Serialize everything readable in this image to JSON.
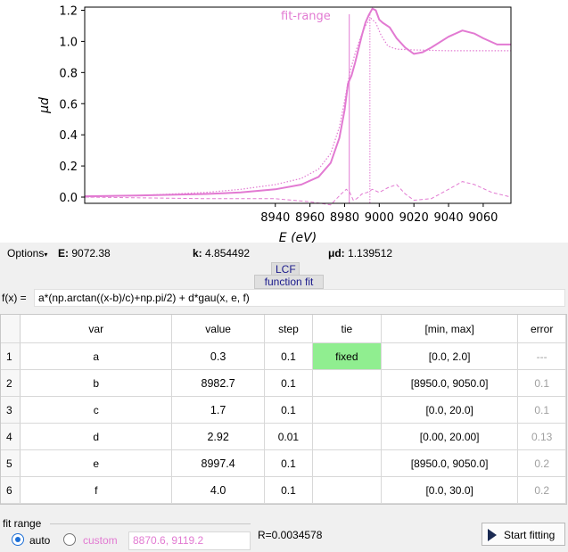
{
  "chart_data": {
    "type": "line",
    "xlabel": "E (eV)",
    "ylabel": "μd",
    "xlim": [
      8830,
      9076
    ],
    "ylim": [
      -0.04,
      1.22
    ],
    "xticks": [
      8940,
      8960,
      8980,
      9000,
      9020,
      9040,
      9060
    ],
    "yticks": [
      "0.0",
      "0.2",
      "0.4",
      "0.6",
      "0.8",
      "1.0",
      "1.2"
    ],
    "annotation": "fit-range",
    "fit_range": [
      8870.6,
      9119.2
    ],
    "markers_x": [
      8982.7,
      8994.6
    ],
    "series": [
      {
        "style": "solid",
        "x": [
          8830,
          8860,
          8900,
          8920,
          8940,
          8955,
          8965,
          8972,
          8977,
          8980,
          8982,
          8984,
          8986,
          8988,
          8990,
          8992,
          8994,
          8996,
          8998,
          9000,
          9002,
          9006,
          9010,
          9015,
          9020,
          9025,
          9030,
          9040,
          9048,
          9055,
          9060,
          9068,
          9076
        ],
        "y": [
          0.005,
          0.01,
          0.02,
          0.03,
          0.05,
          0.08,
          0.13,
          0.22,
          0.38,
          0.56,
          0.73,
          0.78,
          0.86,
          0.95,
          1.04,
          1.12,
          1.17,
          1.21,
          1.2,
          1.14,
          1.12,
          1.09,
          1.02,
          0.96,
          0.92,
          0.93,
          0.96,
          1.03,
          1.07,
          1.05,
          1.02,
          0.98,
          0.98
        ]
      },
      {
        "style": "dotted",
        "x": [
          8830,
          8860,
          8900,
          8920,
          8940,
          8955,
          8965,
          8972,
          8977,
          8980,
          8983,
          8986,
          8989,
          8992,
          8995,
          8998,
          9001,
          9005,
          9010,
          9020,
          9040,
          9076
        ],
        "y": [
          0.0,
          0.01,
          0.03,
          0.05,
          0.08,
          0.12,
          0.18,
          0.28,
          0.45,
          0.62,
          0.8,
          0.92,
          1.02,
          1.1,
          1.15,
          1.12,
          1.04,
          0.97,
          0.95,
          0.945,
          0.94,
          0.94
        ]
      },
      {
        "style": "dashed",
        "x": [
          8830,
          8900,
          8940,
          8960,
          8972,
          8978,
          8981,
          8983,
          8985,
          8987,
          8990,
          8993,
          8996,
          9000,
          9005,
          9010,
          9015,
          9020,
          9030,
          9040,
          9048,
          9055,
          9065,
          9076
        ],
        "y": [
          0.0,
          -0.01,
          -0.01,
          -0.03,
          -0.05,
          0.02,
          0.05,
          0.03,
          -0.02,
          -0.01,
          0.02,
          0.03,
          0.05,
          0.03,
          0.06,
          0.08,
          0.02,
          -0.02,
          -0.01,
          0.05,
          0.1,
          0.08,
          0.03,
          0.0
        ]
      }
    ],
    "colors": {
      "curve": "#e27ad2",
      "axis": "#000000"
    }
  },
  "status": {
    "options_label": "Options",
    "e_label": "E:",
    "e_value": "9072.38",
    "k_label": "k:",
    "k_value": "4.854492",
    "mud_label": "μd:",
    "mud_value": "1.139512"
  },
  "tabs": {
    "lcf": "LCF",
    "function_fit": "function fit"
  },
  "formula": {
    "label": "f(x) =",
    "value": "a*(np.arctan((x-b)/c)+np.pi/2) + d*gau(x, e, f)"
  },
  "table": {
    "headers": [
      "var",
      "value",
      "step",
      "tie",
      "[min, max]",
      "error"
    ],
    "rows": [
      {
        "num": "1",
        "var": "a",
        "value": "0.3",
        "step": "0.1",
        "tie": "fixed",
        "range": "[0.0, 2.0]",
        "error": "---"
      },
      {
        "num": "2",
        "var": "b",
        "value": "8982.7",
        "step": "0.1",
        "tie": "",
        "range": "[8950.0, 9050.0]",
        "error": "0.1"
      },
      {
        "num": "3",
        "var": "c",
        "value": "1.7",
        "step": "0.1",
        "tie": "",
        "range": "[0.0, 20.0]",
        "error": "0.1"
      },
      {
        "num": "4",
        "var": "d",
        "value": "2.92",
        "step": "0.01",
        "tie": "",
        "range": "[0.00, 20.00]",
        "error": "0.13"
      },
      {
        "num": "5",
        "var": "e",
        "value": "8997.4",
        "step": "0.1",
        "tie": "",
        "range": "[8950.0, 9050.0]",
        "error": "0.2"
      },
      {
        "num": "6",
        "var": "f",
        "value": "4.0",
        "step": "0.1",
        "tie": "",
        "range": "[0.0, 30.0]",
        "error": "0.2"
      }
    ]
  },
  "bottom": {
    "fit_range_label": "fit range",
    "auto_label": "auto",
    "custom_label": "custom",
    "range_value": "8870.6, 9119.2",
    "r_factor": "R=0.0034578",
    "start_label": "Start fitting"
  }
}
